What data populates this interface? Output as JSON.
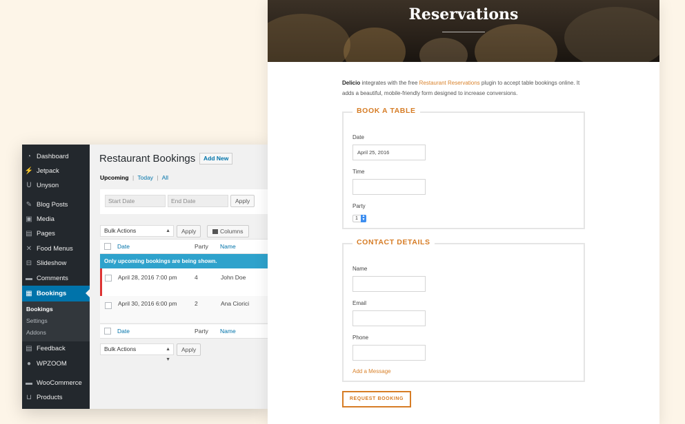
{
  "admin": {
    "sidebar": {
      "items": [
        {
          "label": "Dashboard",
          "icon": "dashboard-icon"
        },
        {
          "label": "Jetpack",
          "icon": "jetpack-icon"
        },
        {
          "label": "Unyson",
          "icon": "unyson-icon"
        },
        {
          "label": "Blog Posts",
          "icon": "pin-icon"
        },
        {
          "label": "Media",
          "icon": "media-icon"
        },
        {
          "label": "Pages",
          "icon": "pages-icon"
        },
        {
          "label": "Food Menus",
          "icon": "utensils-icon"
        },
        {
          "label": "Slideshow",
          "icon": "slideshow-icon"
        },
        {
          "label": "Comments",
          "icon": "comments-icon"
        },
        {
          "label": "Bookings",
          "icon": "calendar-icon"
        },
        {
          "label": "Feedback",
          "icon": "feedback-icon"
        },
        {
          "label": "WPZOOM",
          "icon": "wpzoom-icon"
        },
        {
          "label": "WooCommerce",
          "icon": "woocommerce-icon"
        },
        {
          "label": "Products",
          "icon": "cart-icon"
        }
      ],
      "submenu": [
        "Bookings",
        "Settings",
        "Addons"
      ]
    },
    "page_title": "Restaurant Bookings",
    "add_new": "Add New",
    "views": {
      "upcoming": "Upcoming",
      "today": "Today",
      "all": "All",
      "sep": "|"
    },
    "filters": {
      "start_placeholder": "Start Date",
      "end_placeholder": "End Date",
      "apply": "Apply"
    },
    "bulk": {
      "label": "Bulk Actions",
      "apply": "Apply",
      "columns": "Columns"
    },
    "columns": {
      "date": "Date",
      "party": "Party",
      "name": "Name"
    },
    "notice": "Only upcoming bookings are being shown.",
    "rows": [
      {
        "date": "April 28, 2016 7:00 pm",
        "party": "4",
        "name": "John Doe"
      },
      {
        "date": "April 30, 2016 6:00 pm",
        "party": "2",
        "name": "Ana Ciorici"
      }
    ]
  },
  "front": {
    "hero_title": "Reservations",
    "intro": {
      "brand": "Delicio",
      "text_before": " integrates with the free ",
      "link": "Restaurant Reservations",
      "text_after": " plugin to accept table bookings online. It adds a beautiful, mobile-friendly form designed to increase conversions."
    },
    "book_table": {
      "legend": "BOOK A TABLE",
      "date_label": "Date",
      "date_value": "April 25, 2016",
      "time_label": "Time",
      "party_label": "Party",
      "party_value": "1"
    },
    "contact": {
      "legend": "CONTACT DETAILS",
      "name_label": "Name",
      "email_label": "Email",
      "phone_label": "Phone",
      "add_message": "Add a Message"
    },
    "request_button": "REQUEST BOOKING"
  },
  "colors": {
    "background": "#fdf5e8",
    "wp_sidebar": "#23282d",
    "wp_active": "#0073aa",
    "notice": "#2ea2cc",
    "accent_orange": "#d67c25"
  }
}
